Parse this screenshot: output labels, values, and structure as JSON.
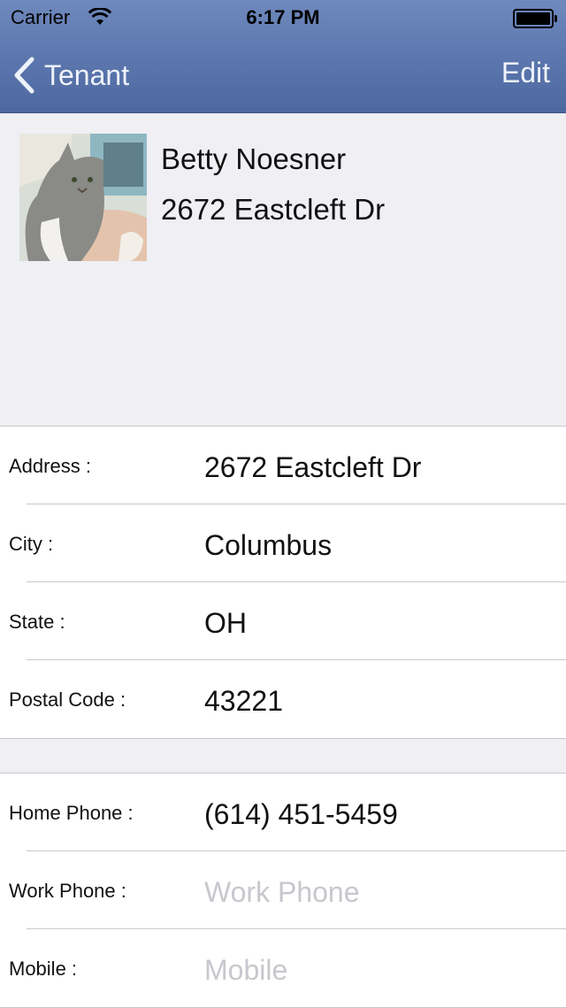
{
  "status_bar": {
    "carrier": "Carrier",
    "time": "6:17 PM"
  },
  "nav": {
    "back_label": "Tenant",
    "edit_label": "Edit"
  },
  "tenant": {
    "name": "Betty Noesner",
    "address_line": "2672 Eastcleft Dr"
  },
  "address_section": [
    {
      "label": "Address :",
      "value": "2672 Eastcleft Dr"
    },
    {
      "label": "City :",
      "value": "Columbus"
    },
    {
      "label": "State :",
      "value": "OH"
    },
    {
      "label": "Postal Code :",
      "value": "43221"
    }
  ],
  "phone_section": [
    {
      "label": "Home Phone :",
      "value": "(614) 451-5459",
      "placeholder": ""
    },
    {
      "label": "Work Phone :",
      "value": "",
      "placeholder": "Work Phone"
    },
    {
      "label": "Mobile :",
      "value": "",
      "placeholder": "Mobile"
    }
  ],
  "colors": {
    "nav_bar": "#5b76ad",
    "background": "#efeff4",
    "placeholder": "#c7c7cd",
    "separator": "#c8c7cc"
  }
}
